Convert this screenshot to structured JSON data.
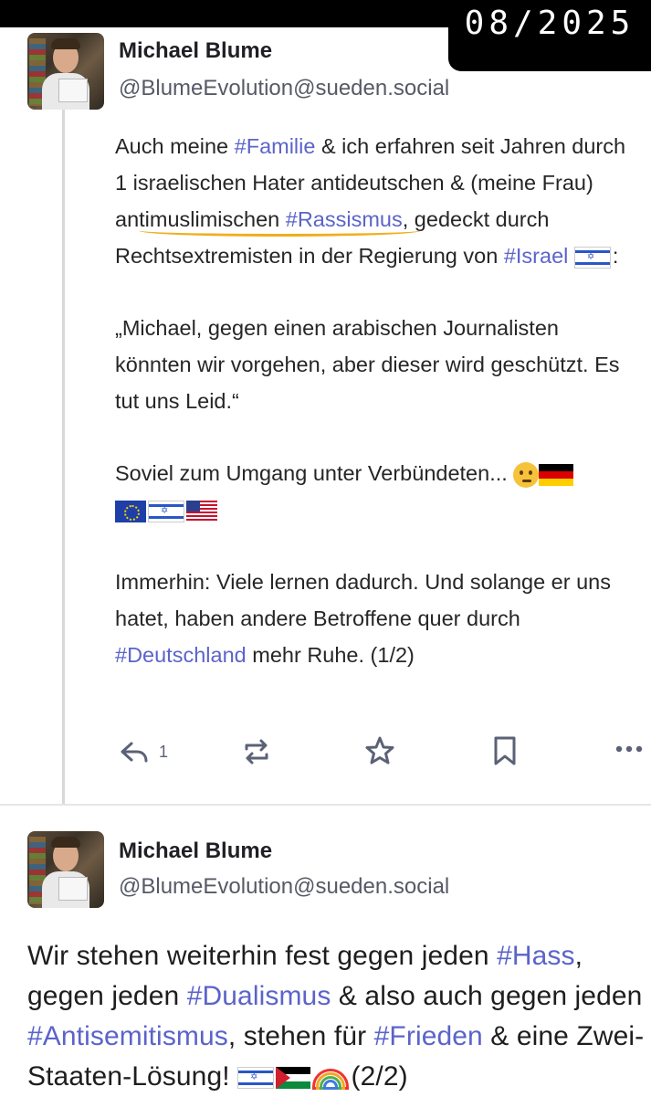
{
  "date_stamp": "08/2025",
  "post1": {
    "author_name": "Michael Blume",
    "author_handle": "@BlumeEvolution@sueden.social",
    "p1": {
      "t1": "Auch meine ",
      "tag1": "#Familie",
      "t2": " & ich erfahren seit Jahren durch 1 israelischen Hater antideutschen & (meine Frau) an",
      "underlined": "timuslimischen ",
      "tag2": "#Rassismus",
      "t3": ", gedeckt durch Rechtsextremisten in der Regierung von ",
      "tag3": "#Israel",
      "t4": ":"
    },
    "p2": "„Michael, gegen einen arabischen Journalisten könnten wir vorgehen, aber dieser wird geschützt. Es tut uns Leid.“",
    "p3": "Soviel zum Umgang unter Verbündeten...",
    "p4": {
      "t1": "Immerhin: Viele lernen dadurch. Und solange er uns hatet, haben andere Betroffene quer durch ",
      "tag1": "#Deutschland",
      "t2": " mehr Ruhe. (1/2)"
    },
    "reply_count": "1"
  },
  "post2": {
    "author_name": "Michael Blume",
    "author_handle": "@BlumeEvolution@sueden.social",
    "t1": "Wir stehen weiterhin fest gegen jeden ",
    "tag1": "#Hass",
    "t2": ", gegen jeden ",
    "tag2": "#Dualismus",
    "t3": " & also auch gegen jeden ",
    "tag3": "#Antisemitismus",
    "t4": ",  stehen für ",
    "tag4": "#Frieden",
    "t5": " & eine Zwei-Staaten-Lösung! ",
    "t6": " (2/2)"
  },
  "colors": {
    "hashtag": "#5b64c9",
    "underline_highlight": "#f0ae1e",
    "icon": "#5b6275"
  },
  "icons": [
    "reply-icon",
    "boost-icon",
    "favourite-star-icon",
    "bookmark-icon",
    "more-options-icon"
  ]
}
